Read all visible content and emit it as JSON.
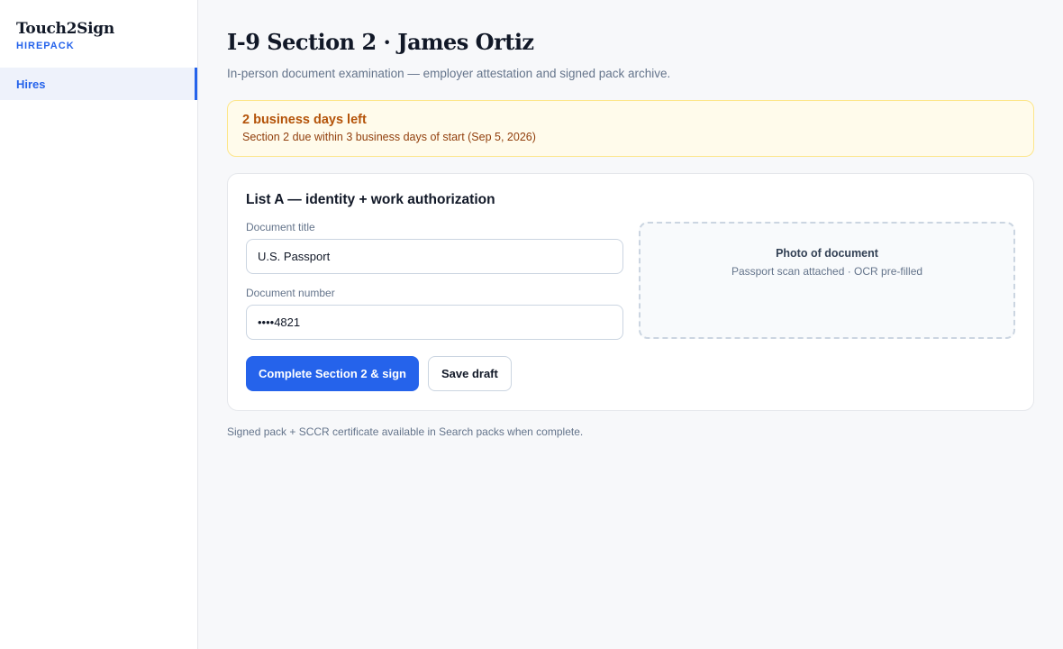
{
  "brand": {
    "name": "Touch2Sign",
    "sub": "HIREPACK"
  },
  "sidebar": {
    "items": [
      {
        "label": "Hires",
        "active": true
      }
    ]
  },
  "page": {
    "title": "I-9 Section 2 · James Ortiz",
    "subtitle": "In-person document examination — employer attestation and signed pack archive."
  },
  "alert": {
    "title": "2 business days left",
    "text": "Section 2 due within 3 business days of start (Sep 5, 2026)"
  },
  "card": {
    "title": "List A — identity + work authorization",
    "document_title": {
      "label": "Document title",
      "value": "U.S. Passport"
    },
    "document_number": {
      "label": "Document number",
      "value": "••••4821"
    },
    "photo": {
      "title": "Photo of document",
      "subtitle": "Passport scan attached · OCR pre-filled"
    },
    "primary_button": "Complete Section 2 & sign",
    "secondary_button": "Save draft"
  },
  "footnote": "Signed pack + SCCR certificate available in Search packs when complete.",
  "colors": {
    "accent": "#2563eb",
    "warning_bg": "#fffbeb",
    "warning_text": "#b45309"
  }
}
